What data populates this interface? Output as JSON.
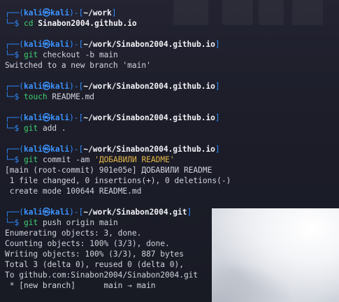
{
  "prompt": {
    "corner_top": "┌──",
    "corner_bottom": "└─",
    "user": "kali",
    "at_glyph": "㉿",
    "host": "kali",
    "open_paren": "(",
    "close_paren": ")",
    "dash": "-",
    "open_bracket": "[",
    "close_bracket": "]",
    "dollar": "$"
  },
  "blocks": [
    {
      "path": "~/work",
      "command": "cd",
      "args": [
        {
          "text": "Sinabon2004.github.io",
          "kind": "arg"
        }
      ],
      "output": []
    },
    {
      "path": "~/work/Sinabon2004.github.io",
      "command": "git",
      "args": [
        {
          "text": "checkout",
          "kind": "flag"
        },
        {
          "text": "-b",
          "kind": "flag"
        },
        {
          "text": "main",
          "kind": "flag"
        }
      ],
      "output": [
        "Switched to a new branch 'main'"
      ]
    },
    {
      "path": "~/work/Sinabon2004.github.io",
      "command": "touch",
      "args": [
        {
          "text": "README.md",
          "kind": "flag"
        }
      ],
      "output": []
    },
    {
      "path": "~/work/Sinabon2004.github.io",
      "command": "git",
      "args": [
        {
          "text": "add",
          "kind": "flag"
        },
        {
          "text": ".",
          "kind": "flag"
        }
      ],
      "output": []
    },
    {
      "path": "~/work/Sinabon2004.github.io",
      "command": "git",
      "args": [
        {
          "text": "commit",
          "kind": "flag"
        },
        {
          "text": "-am",
          "kind": "flag"
        },
        {
          "text": "'ДОБАВИЛИ README'",
          "kind": "str"
        }
      ],
      "output": [
        "[main (root-commit) 901e05e] ДОБАВИЛИ README",
        " 1 file changed, 0 insertions(+), 0 deletions(-)",
        " create mode 100644 README.md"
      ]
    },
    {
      "path": "~/work/Sinabon2004.git",
      "command": "git",
      "args": [
        {
          "text": "push",
          "kind": "flag"
        },
        {
          "text": "origin",
          "kind": "flag"
        },
        {
          "text": "main",
          "kind": "flag"
        }
      ],
      "output": [
        "Enumerating objects: 3, done.",
        "Counting objects: 100% (3/3), done.",
        "Writing objects: 100% (3/3), 887 bytes",
        "Total 3 (delta 0), reused 0 (delta 0),",
        "To github.com:Sinabon2004/Sinabon2004.git",
        " * [new branch]      main → main"
      ]
    }
  ],
  "colors": {
    "prompt_blue": "#2f8bff",
    "command_green": "#3fd070",
    "string_yellow": "#e6b84a",
    "path_white": "#f2f3f7",
    "output_gray": "#d2d4dc"
  }
}
